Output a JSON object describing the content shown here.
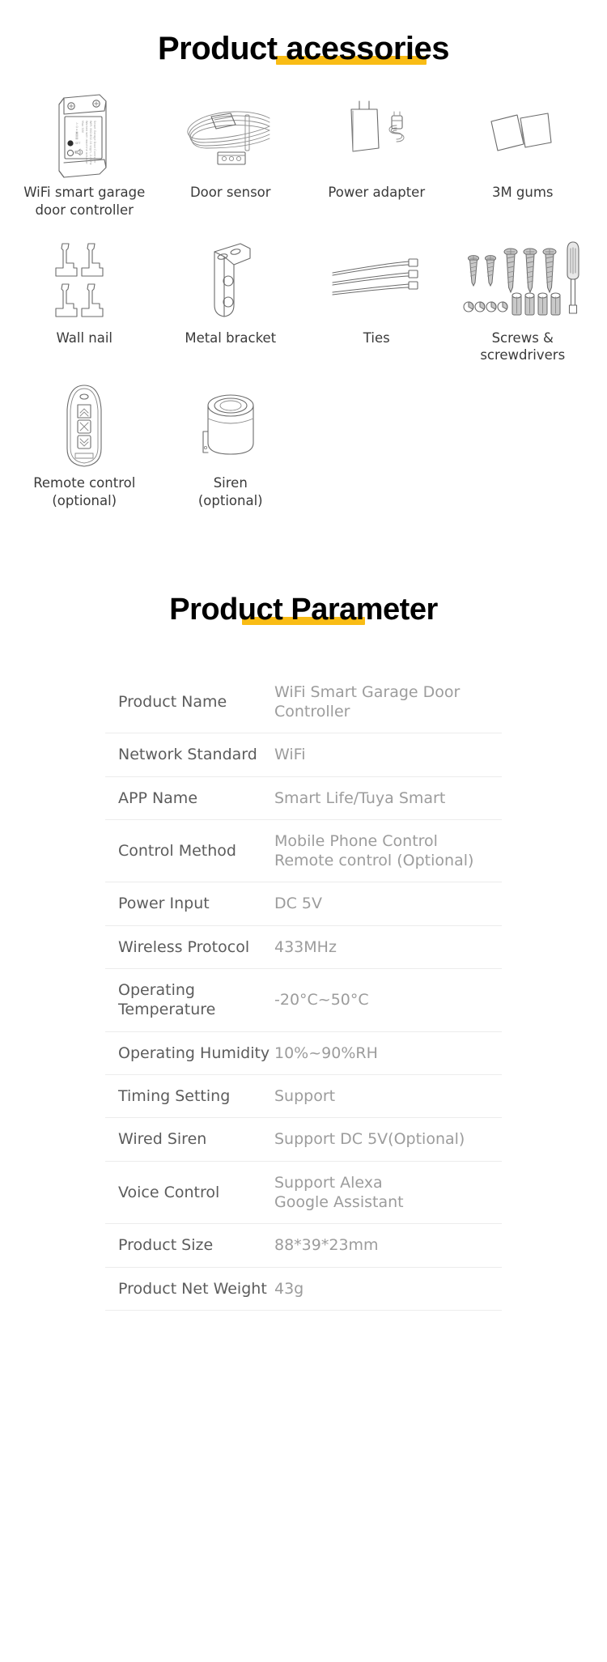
{
  "sections": {
    "accessories": {
      "heading_text": "Product acessories",
      "highlight_color": "#f9bc15",
      "items": [
        {
          "label": "WiFi smart garage\ndoor controller",
          "icon": "controller-icon"
        },
        {
          "label": "Door sensor",
          "icon": "door-sensor-icon"
        },
        {
          "label": "Power adapter",
          "icon": "power-adapter-icon"
        },
        {
          "label": "3M gums",
          "icon": "adhesive-pads-icon"
        },
        {
          "label": "Wall nail",
          "icon": "wall-nail-icon"
        },
        {
          "label": "Metal bracket",
          "icon": "metal-bracket-icon"
        },
        {
          "label": "Ties",
          "icon": "cable-ties-icon"
        },
        {
          "label": "Screws & screwdrivers",
          "icon": "screws-screwdriver-icon"
        },
        {
          "label": "Remote control\n(optional)",
          "icon": "remote-control-icon"
        },
        {
          "label": "Siren\n(optional)",
          "icon": "siren-icon"
        }
      ],
      "device_label_lines": [
        "Smart Garage Door Controller",
        "WiFi: 802.802.11 b/g/n, 2.4GHz",
        "Worked with machine actuator",
        "Max 30V"
      ]
    },
    "parameter": {
      "heading_text": "Product Parameter",
      "highlight_color": "#f9bc15",
      "rows": [
        {
          "key": "Product Name",
          "value": "WiFi Smart Garage Door\nController"
        },
        {
          "key": "Network Standard",
          "value": "WiFi"
        },
        {
          "key": "APP Name",
          "value": "Smart Life/Tuya Smart"
        },
        {
          "key": "Control Method",
          "value": "Mobile Phone Control\nRemote control (Optional)"
        },
        {
          "key": "Power Input",
          "value": "DC 5V"
        },
        {
          "key": "Wireless Protocol",
          "value": "433MHz"
        },
        {
          "key": "Operating Temperature",
          "value": "-20°C~50°C"
        },
        {
          "key": "Operating Humidity",
          "value": "10%~90%RH"
        },
        {
          "key": "Timing Setting",
          "value": "Support"
        },
        {
          "key": "Wired Siren",
          "value": "Support DC 5V(Optional)"
        },
        {
          "key": "Voice Control",
          "value": "Support Alexa\nGoogle Assistant"
        },
        {
          "key": "Product Size",
          "value": "88*39*23mm"
        },
        {
          "key": "Product Net Weight",
          "value": "43g"
        }
      ]
    }
  }
}
